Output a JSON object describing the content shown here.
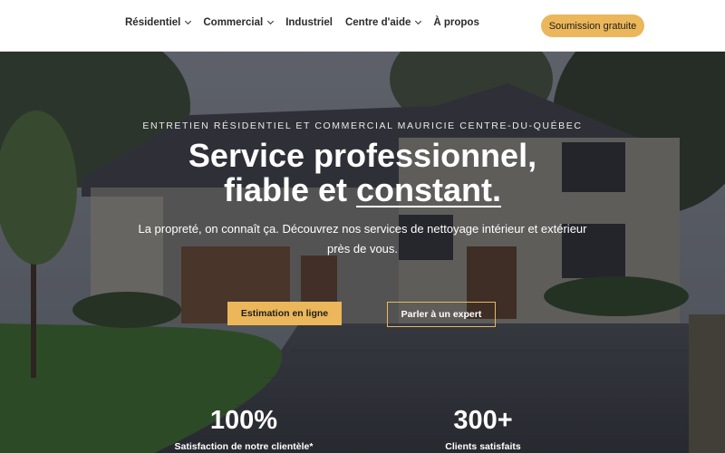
{
  "nav": {
    "items": [
      {
        "label": "Résidentiel",
        "dropdown": true
      },
      {
        "label": "Commercial",
        "dropdown": true
      },
      {
        "label": "Industriel",
        "dropdown": false
      },
      {
        "label": "Centre d'aide",
        "dropdown": true
      },
      {
        "label": "À propos",
        "dropdown": false
      }
    ],
    "cta": "Soumission gratuite"
  },
  "hero": {
    "eyebrow": "ENTRETIEN RÉSIDENTIEL ET COMMERCIAL MAURICIE CENTRE-DU-QUÉBEC",
    "headline_line1": "Service professionnel,",
    "headline_line2_a": "fiable et ",
    "headline_line2_b": "constant.",
    "subtitle": "La propreté, on connaît ça. Découvrez nos services de nettoyage intérieur et extérieur près de vous.",
    "primary_button": "Estimation en ligne",
    "secondary_button": "Parler à un expert",
    "stats": [
      {
        "value": "100%",
        "label": "Satisfaction de notre clientèle*"
      },
      {
        "value": "300+",
        "label": "Clients satisfaits"
      }
    ]
  },
  "colors": {
    "accent": "#ebb75a",
    "nav_bg": "#ffffff",
    "nav_text": "#2b2b2b"
  }
}
